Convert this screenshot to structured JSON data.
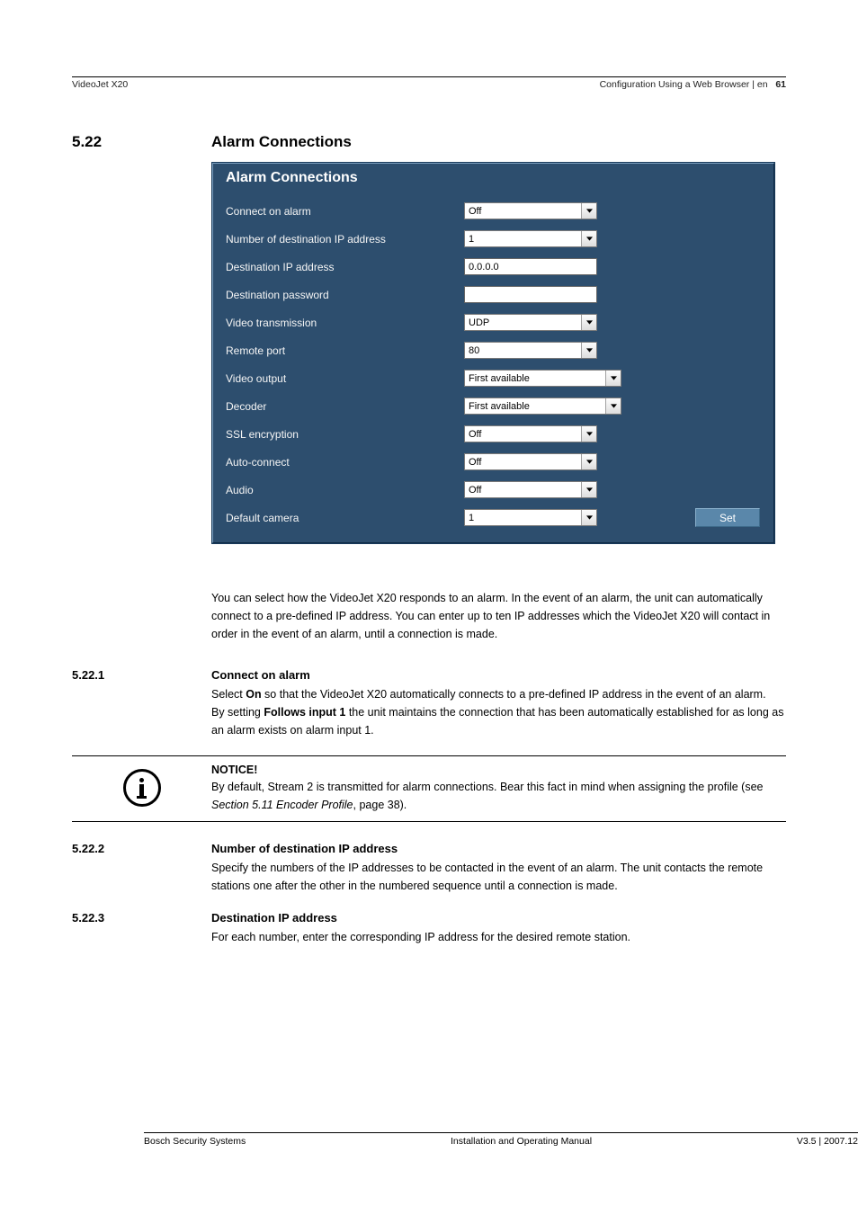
{
  "header": {
    "product": "VideoJet X20",
    "breadcrumb": "Configuration Using a Web Browser | en",
    "pageNum": "61"
  },
  "section": {
    "num": "5.22",
    "title": "Alarm Connections"
  },
  "panel": {
    "title": "Alarm Connections",
    "setButton": "Set",
    "rows": {
      "connectOnAlarm": {
        "label": "Connect on alarm",
        "value": "Off"
      },
      "numberDest": {
        "label": "Number of destination IP address",
        "value": "1"
      },
      "destIp": {
        "label": "Destination IP address",
        "value": "0.0.0.0"
      },
      "destPassword": {
        "label": "Destination password",
        "value": ""
      },
      "videoTransmission": {
        "label": "Video transmission",
        "value": "UDP"
      },
      "remotePort": {
        "label": "Remote port",
        "value": "80"
      },
      "videoOutput": {
        "label": "Video output",
        "value": "First available"
      },
      "decoder": {
        "label": "Decoder",
        "value": "First available"
      },
      "sslEncryption": {
        "label": "SSL encryption",
        "value": "Off"
      },
      "autoConnect": {
        "label": "Auto-connect",
        "value": "Off"
      },
      "audio": {
        "label": "Audio",
        "value": "Off"
      },
      "defaultCamera": {
        "label": "Default camera",
        "value": "1"
      }
    }
  },
  "intro": "You can select how the VideoJet X20 responds to an alarm. In the event of an alarm, the unit can automatically connect to a pre-defined IP address. You can enter up to ten IP addresses which the VideoJet X20 will contact in order in the event of an alarm, until a connection is made.",
  "sub1": {
    "num": "5.22.1",
    "title": "Connect on alarm",
    "p1a": "Select ",
    "p1b": "On",
    "p1c": " so that the VideoJet X20 automatically connects to a pre-defined IP address in the event of an alarm.",
    "p2a": "By setting ",
    "p2b": "Follows input 1",
    "p2c": " the unit maintains the connection that has been automatically established for as long as an alarm exists on alarm input 1."
  },
  "notice": {
    "heading": "NOTICE!",
    "t1": "By default, Stream 2 is transmitted for alarm connections. Bear this fact in mind when assigning the profile (see ",
    "t2": "Section 5.11 Encoder Profile",
    "t3": ", page 38)."
  },
  "sub2": {
    "num": "5.22.2",
    "title": "Number of destination IP address",
    "text": "Specify the numbers of the IP addresses to be contacted in the event of an alarm. The unit contacts the remote stations one after the other in the numbered sequence until a connection is made."
  },
  "sub3": {
    "num": "5.22.3",
    "title": "Destination IP address",
    "text": "For each number, enter the corresponding IP address for the desired remote station."
  },
  "footer": {
    "left": "Bosch Security Systems",
    "center": "Installation and Operating Manual",
    "right": "V3.5 | 2007.12"
  }
}
